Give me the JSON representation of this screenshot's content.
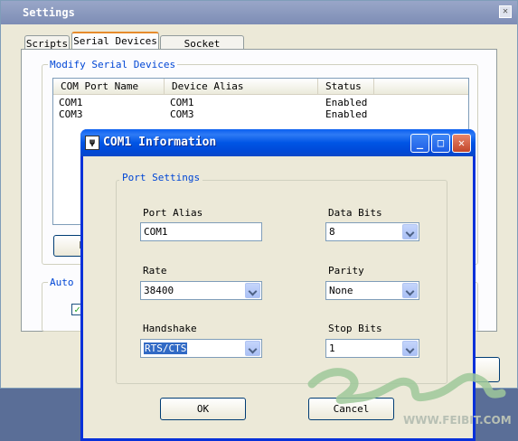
{
  "settings_window": {
    "title": "Settings",
    "close_glyph": "✕",
    "tabs": [
      {
        "label": "Scripts",
        "active": false
      },
      {
        "label": "Serial Devices",
        "active": true
      },
      {
        "label": "Socket Devices",
        "active": false
      }
    ],
    "modify_group_label": "Modify Serial Devices",
    "columns": [
      "COM Port Name",
      "Device Alias",
      "Status"
    ],
    "rows": [
      {
        "port": "COM1",
        "alias": "COM1",
        "status": "Enabled"
      },
      {
        "port": "COM3",
        "alias": "COM3",
        "status": "Enabled"
      }
    ],
    "auto_group_label_partial": "Auto S",
    "partial_button_label": "E"
  },
  "dialog": {
    "title": "COM1 Information",
    "icon": "ti-app-icon",
    "group_label": "Port Settings",
    "port_alias": {
      "label": "Port Alias",
      "value": "COM1"
    },
    "data_bits": {
      "label": "Data Bits",
      "value": "8"
    },
    "rate": {
      "label": "Rate",
      "value": "38400"
    },
    "parity": {
      "label": "Parity",
      "value": "None"
    },
    "handshake": {
      "label": "Handshake",
      "value": "RTS/CTS"
    },
    "stop_bits": {
      "label": "Stop Bits",
      "value": "1"
    },
    "ok_label": "OK",
    "cancel_label": "Cancel",
    "caption_buttons": {
      "minimize": "_",
      "maximize": "□",
      "close": "✕"
    }
  },
  "watermark": {
    "text": "WWW.FEIBIT.COM"
  },
  "colors": {
    "xp_title_blue": "#0055e5",
    "group_label_blue": "#0046d5",
    "selection_blue": "#316ac5",
    "dialog_face": "#ece9d8"
  }
}
